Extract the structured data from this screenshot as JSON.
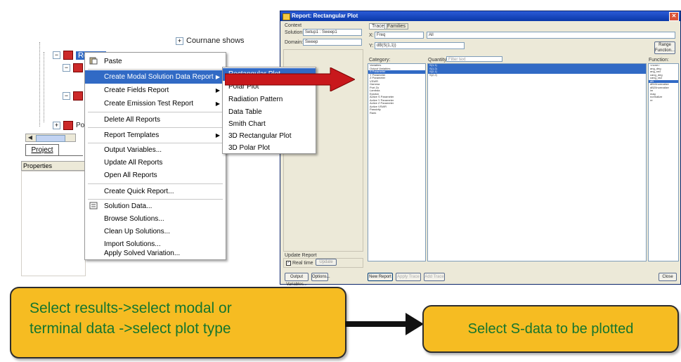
{
  "tree": {
    "results_label": "Results",
    "top_item": "Cournane shows",
    "port_label": "Port",
    "tab_project": "Project",
    "properties_header": "Properties"
  },
  "context_menu": {
    "items": [
      {
        "label": "Paste",
        "highlight": false,
        "submenu": false
      },
      {
        "label": "Create Modal Solution Data Report",
        "highlight": true,
        "submenu": true
      },
      {
        "label": "Create Fields Report",
        "highlight": false,
        "submenu": true
      },
      {
        "label": "Create Emission Test Report",
        "highlight": false,
        "submenu": true
      },
      {
        "label": "Delete All Reports",
        "highlight": false,
        "submenu": false
      },
      {
        "label": "Report Templates",
        "highlight": false,
        "submenu": true
      },
      {
        "label": "Output Variables...",
        "highlight": false,
        "submenu": false
      },
      {
        "label": "Update All Reports",
        "highlight": false,
        "submenu": false
      },
      {
        "label": "Open All Reports",
        "highlight": false,
        "submenu": false
      },
      {
        "label": "Create Quick Report...",
        "highlight": false,
        "submenu": false
      },
      {
        "label": "Solution Data...",
        "highlight": false,
        "submenu": false
      },
      {
        "label": "Browse Solutions...",
        "highlight": false,
        "submenu": false
      },
      {
        "label": "Clean Up Solutions...",
        "highlight": false,
        "submenu": false
      },
      {
        "label": "Import Solutions...",
        "highlight": false,
        "submenu": false
      },
      {
        "label": "Apply Solved Variation...",
        "highlight": false,
        "submenu": false
      }
    ]
  },
  "submenu": {
    "items": [
      {
        "label": "Rectangular Plot",
        "highlight": true
      },
      {
        "label": "Polar Plot",
        "highlight": false
      },
      {
        "label": "Radiation Pattern",
        "highlight": false
      },
      {
        "label": "Data Table",
        "highlight": false
      },
      {
        "label": "Smith Chart",
        "highlight": false
      },
      {
        "label": "3D Rectangular Plot",
        "highlight": false
      },
      {
        "label": "3D Polar Plot",
        "highlight": false
      }
    ]
  },
  "dialog": {
    "title": "Report: Rectangular Plot",
    "context_label": "Context",
    "solution_label": "Solution:",
    "solution_value": "Setup1 : Sweep1",
    "domain_label": "Domain:",
    "domain_value": "Sweep",
    "tab_trace": "Trace",
    "tab_families": "Families",
    "x_label": "X:",
    "x_value": "Freq",
    "x_default": "All",
    "y_label": "Y:",
    "y_value": "dB(S(1,1))",
    "range_button": "Range Function...",
    "category_header": "Category:",
    "quantity_header": "Quantity:",
    "quantity_filter": "Filter text",
    "function_header": "Function:",
    "categories": [
      "Variables",
      "Output Variables",
      "S Parameter",
      "Y Parameter",
      "Z Parameter",
      "VSWR",
      "Gamma",
      "Port Zo",
      "Lambda",
      "Epsilon",
      "Active S Parameter",
      "Active Y Parameter",
      "Active Z Parameter",
      "Active VSWR",
      "Passivity",
      "Rank"
    ],
    "quantities": [
      "S(1,1)",
      "S(1,2)",
      "S(2,1)",
      "S(2,2)"
    ],
    "functions": [
      "<none>",
      "ang_deg",
      "ang_rad",
      "cang_deg",
      "cang_rad",
      "dB",
      "dB10normalize",
      "dB20normalize",
      "im",
      "mag",
      "normalize",
      "re"
    ],
    "update_report_label": "Update Report",
    "realtime_label": "Real time",
    "update_button": "Update",
    "output_variables_button": "Output Variables...",
    "options_button": "Options...",
    "new_report_button": "New Report",
    "apply_trace_button": "Apply Trace",
    "add_trace_button": "Add Trace",
    "close_button": "Close"
  },
  "notes": {
    "left_line1": "Select results->select modal or",
    "left_line2": "terminal data ->select plot type",
    "right": "Select S-data to be plotted"
  },
  "colors": {
    "highlight": "#316ac5",
    "note_fill": "#f6bc22",
    "note_text": "#15752e",
    "arrow_red": "#c8181c"
  }
}
